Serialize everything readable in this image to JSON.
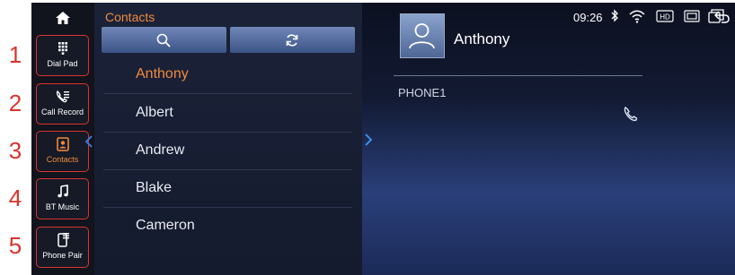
{
  "steps": [
    "1",
    "2",
    "3",
    "4",
    "5"
  ],
  "nav": [
    {
      "label": "Dial Pad",
      "icon": "dial-pad-icon"
    },
    {
      "label": "Call Record",
      "icon": "call-record-icon"
    },
    {
      "label": "Contacts",
      "icon": "contacts-icon"
    },
    {
      "label": "BT Music",
      "icon": "music-note-icon"
    },
    {
      "label": "Phone Pair",
      "icon": "phone-pair-icon"
    }
  ],
  "contacts": {
    "title": "Contacts",
    "search_icon": "search-icon",
    "sync_icon": "sync-icon",
    "list": [
      "Anthony",
      "Albert",
      "Andrew",
      "Blake",
      "Cameron"
    ],
    "selected": "Anthony"
  },
  "detail": {
    "name": "Anthony",
    "phone_label": "PHONE1",
    "call_icon": "call-handset-icon"
  },
  "status_bar": {
    "time": "09:26",
    "icons": [
      "bluetooth-icon",
      "wifi-icon",
      "hd-icon",
      "screen-cast-icon",
      "window-icon",
      "back-icon"
    ]
  },
  "colors": {
    "accent": "#f08a3c",
    "annotation": "#d9342b",
    "highlight": "#3a8ee8"
  }
}
